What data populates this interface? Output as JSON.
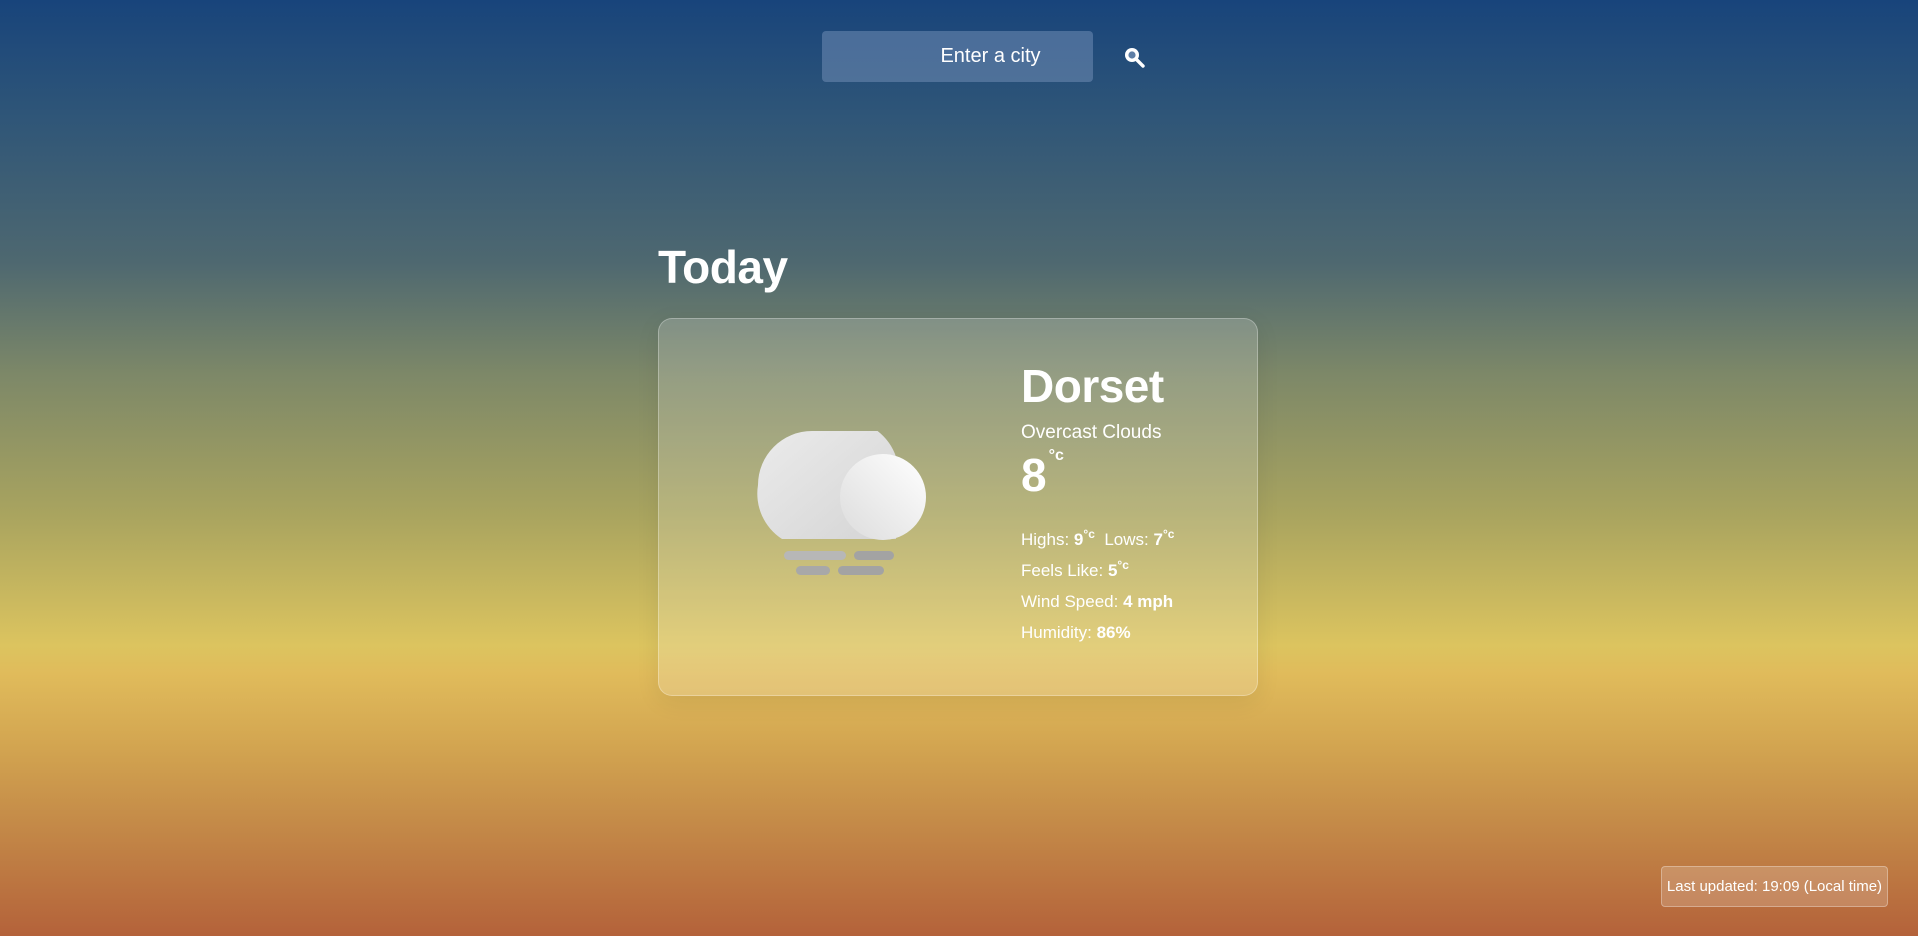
{
  "search": {
    "placeholder": "Enter a city",
    "icon": "search-icon"
  },
  "today_heading": "Today",
  "weather": {
    "city": "Dorset",
    "condition": "Overcast Clouds",
    "temperature": "8",
    "unit": "°c",
    "icon": "cloudy-mist-icon",
    "highs_label": "Highs:",
    "highs_value": "9",
    "lows_label": "Lows:",
    "lows_value": "7",
    "feels_like_label": "Feels Like:",
    "feels_like_value": "5",
    "wind_label": "Wind Speed:",
    "wind_value": "4 mph",
    "humidity_label": "Humidity:",
    "humidity_value": "86%"
  },
  "footer": {
    "last_updated": "Last updated: 19:09 (Local time)"
  }
}
